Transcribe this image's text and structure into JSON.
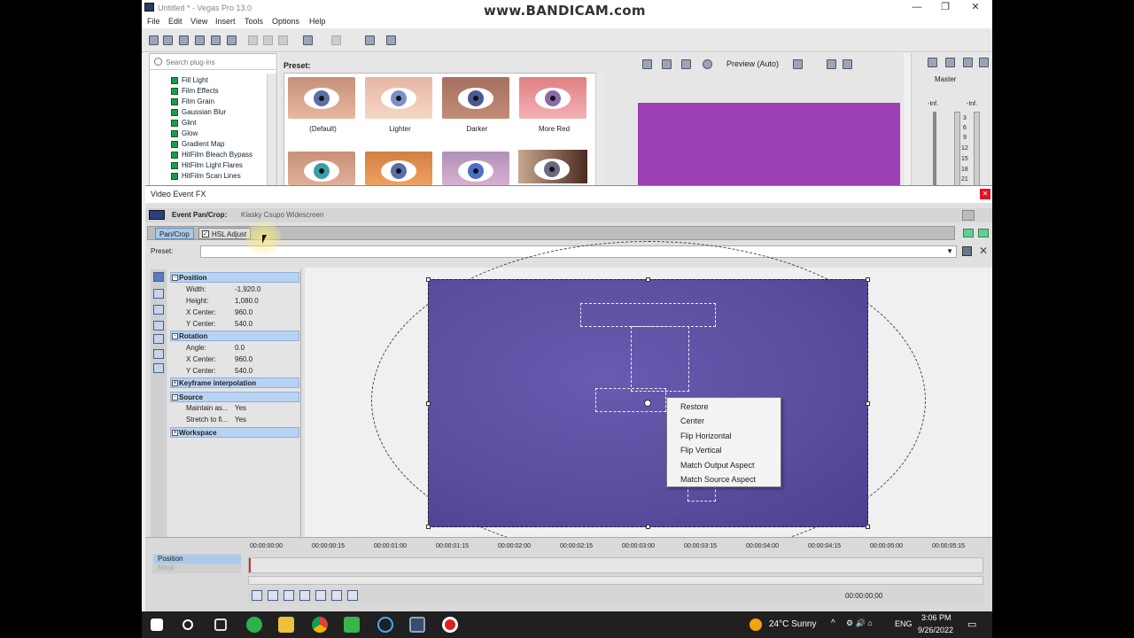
{
  "window": {
    "title": "Untitled * - Vegas Pro 13.0",
    "watermark": "www.BANDICAM.com",
    "minimize": "—",
    "maximize": "❐",
    "close": "✕"
  },
  "menu": [
    "File",
    "Edit",
    "View",
    "Insert",
    "Tools",
    "Options",
    "Help"
  ],
  "plugins": {
    "search_placeholder": "Search plug-ins",
    "items": [
      "Fill Light",
      "Film Effects",
      "Film Grain",
      "Gaussian Blur",
      "Glint",
      "Glow",
      "Gradient Map",
      "HitFilm Bleach Bypass",
      "HitFilm Light Flares",
      "HitFilm Scan Lines"
    ]
  },
  "presets": {
    "label": "Preset:",
    "tiles": [
      "(Default)",
      "Lighter",
      "Darker",
      "More Red"
    ]
  },
  "preview": {
    "label": "Preview (Auto)"
  },
  "master": {
    "label": "Master",
    "left_level": "-Inf.",
    "right_level": "-Inf.",
    "ticks": [
      "3",
      "6",
      "9",
      "12",
      "15",
      "18",
      "21"
    ]
  },
  "vefx": {
    "title": "Video Event FX",
    "header_label": "Event Pan/Crop:",
    "header_value": "Klasky Csupo Widescreen",
    "chain": [
      "Pan/Crop",
      "HSL Adjust"
    ],
    "preset_label": "Preset:"
  },
  "properties": {
    "groups": [
      "Position",
      "Rotation",
      "Keyframe interpolation",
      "Source",
      "Workspace"
    ],
    "position": [
      {
        "label": "Width:",
        "value": "-1,920.0"
      },
      {
        "label": "Height:",
        "value": "1,080.0"
      },
      {
        "label": "X Center:",
        "value": "960.0"
      },
      {
        "label": "Y Center:",
        "value": "540.0"
      }
    ],
    "rotation": [
      {
        "label": "Angle:",
        "value": "0.0"
      },
      {
        "label": "X Center:",
        "value": "960.0"
      },
      {
        "label": "Y Center:",
        "value": "540.0"
      }
    ],
    "source": [
      {
        "label": "Maintain as...",
        "value": "Yes"
      },
      {
        "label": "Stretch to fi...",
        "value": "Yes"
      }
    ]
  },
  "context_menu": [
    "Restore",
    "Center",
    "Flip Horizontal",
    "Flip Vertical",
    "Match Output Aspect",
    "Match Source Aspect"
  ],
  "timeline": {
    "tracks": [
      "Position",
      "Mask"
    ],
    "ticks": [
      "00:00:00:00",
      "00:00:00:15",
      "00:00:01:00",
      "00:00:01:15",
      "00:00:02:00",
      "00:00:02:15",
      "00:00:03:00",
      "00:00:03:15",
      "00:00:04:00",
      "00:00:04:15",
      "00:00:05:00",
      "00:00:05:15"
    ],
    "cursor_time": "00:00:00;00"
  },
  "taskbar": {
    "weather": "24°C  Sunny",
    "lang": "ENG",
    "time": "3:06 PM",
    "date": "9/26/2022"
  }
}
